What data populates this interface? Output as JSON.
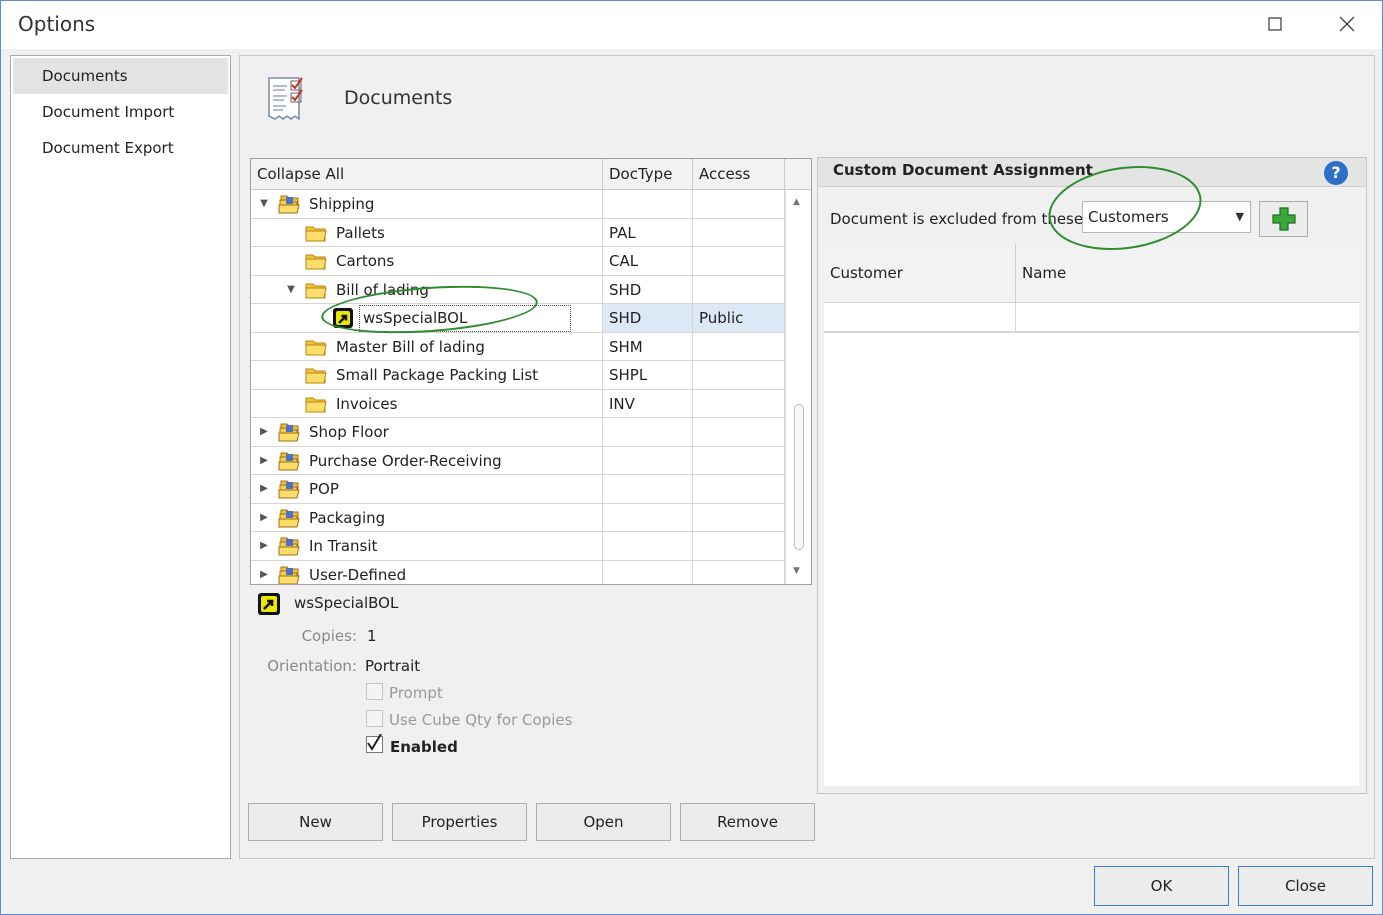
{
  "window": {
    "title": "Options"
  },
  "sidebar": {
    "items": [
      {
        "label": "Documents",
        "selected": true
      },
      {
        "label": "Document Import",
        "selected": false
      },
      {
        "label": "Document Export",
        "selected": false
      }
    ]
  },
  "header": {
    "title": "Documents",
    "icon": "document-checklist-icon"
  },
  "grid": {
    "columns": [
      "Collapse All",
      "DocType",
      "Access"
    ],
    "rows": [
      {
        "label": "Shipping",
        "doctype": "",
        "access": "",
        "level": 0,
        "state": "expanded",
        "icon": "folder-stack-icon"
      },
      {
        "label": "Pallets",
        "doctype": "PAL",
        "access": "",
        "level": 1,
        "state": "none",
        "icon": "folder-icon"
      },
      {
        "label": "Cartons",
        "doctype": "CAL",
        "access": "",
        "level": 1,
        "state": "none",
        "icon": "folder-icon"
      },
      {
        "label": "Bill of lading",
        "doctype": "SHD",
        "access": "",
        "level": 1,
        "state": "expanded",
        "icon": "folder-icon"
      },
      {
        "label": "wsSpecialBOL",
        "doctype": "SHD",
        "access": "Public",
        "level": 2,
        "state": "none",
        "icon": "custom-document-icon",
        "selected": true
      },
      {
        "label": "Master Bill of lading",
        "doctype": "SHM",
        "access": "",
        "level": 1,
        "state": "none",
        "icon": "folder-icon"
      },
      {
        "label": "Small Package Packing List",
        "doctype": "SHPL",
        "access": "",
        "level": 1,
        "state": "none",
        "icon": "folder-icon"
      },
      {
        "label": "Invoices",
        "doctype": "INV",
        "access": "",
        "level": 1,
        "state": "none",
        "icon": "folder-icon"
      },
      {
        "label": "Shop Floor",
        "doctype": "",
        "access": "",
        "level": 0,
        "state": "collapsed",
        "icon": "folder-stack-icon"
      },
      {
        "label": "Purchase Order-Receiving",
        "doctype": "",
        "access": "",
        "level": 0,
        "state": "collapsed",
        "icon": "folder-stack-icon"
      },
      {
        "label": "POP",
        "doctype": "",
        "access": "",
        "level": 0,
        "state": "collapsed",
        "icon": "folder-stack-icon"
      },
      {
        "label": "Packaging",
        "doctype": "",
        "access": "",
        "level": 0,
        "state": "collapsed",
        "icon": "folder-stack-icon"
      },
      {
        "label": "In Transit",
        "doctype": "",
        "access": "",
        "level": 0,
        "state": "collapsed",
        "icon": "folder-stack-icon"
      },
      {
        "label": "User-Defined",
        "doctype": "",
        "access": "",
        "level": 0,
        "state": "collapsed",
        "icon": "folder-stack-icon"
      }
    ]
  },
  "details": {
    "name": "wsSpecialBOL",
    "copies_label": "Copies:",
    "copies_value": "1",
    "orientation_label": "Orientation:",
    "orientation_value": "Portrait",
    "prompt_label": "Prompt",
    "prompt_checked": false,
    "cube_label": "Use Cube Qty  for Copies",
    "cube_checked": false,
    "enabled_label": "Enabled",
    "enabled_checked": true
  },
  "actions": {
    "new": "New",
    "properties": "Properties",
    "open": "Open",
    "remove": "Remove"
  },
  "custom": {
    "title": "Custom Document Assignment",
    "help": "?",
    "excluded_label": "Document is excluded from these:",
    "excluded_value": "Customers",
    "columns": [
      "Customer",
      "Name"
    ]
  },
  "footer": {
    "ok": "OK",
    "close": "Close"
  },
  "colors": {
    "accent": "#3c7fd0",
    "annotation": "#2e8b2e",
    "help": "#2b6fc6",
    "add": "#3aa83a"
  }
}
